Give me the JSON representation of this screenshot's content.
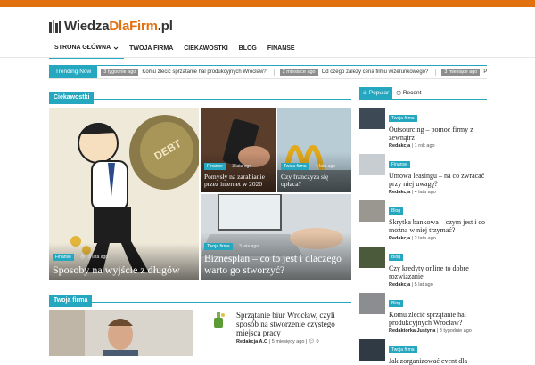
{
  "header": {
    "logo_prefix": "Wiedza",
    "logo_accent": "DlaFirm",
    "logo_suffix": ".pl",
    "accent_color": "#e1700e",
    "theme_color": "#25a7bf"
  },
  "nav": {
    "items": [
      {
        "label": "STRONA GŁÓWNA"
      },
      {
        "label": "TWOJA FIRMA"
      },
      {
        "label": "CIEKAWOSTKI"
      },
      {
        "label": "BLOG"
      },
      {
        "label": "FINANSE"
      }
    ]
  },
  "trending": {
    "label": "Trending Now",
    "items": [
      {
        "time": "3 tygodnie ago",
        "title": "Komu zlecić sprzątanie hal produkcyjnych Wrocław?"
      },
      {
        "time": "2 miesiące ago",
        "title": "Od czego zależy cena filmu wizerunkowego?"
      },
      {
        "time": "3 miesiące ago",
        "title": "P"
      }
    ]
  },
  "ciekawostki": {
    "heading": "Ciekawostki",
    "tiles": [
      {
        "category": "Finanse",
        "time": "3 lata ago",
        "title": "Sposoby na wyjście z długów"
      },
      {
        "category": "Finanse",
        "time": "3 lata ago",
        "title": "Pomysły na zarabianie przez internet w 2020"
      },
      {
        "category": "Twoja firma",
        "time": "4 lata ago",
        "title": "Czy franczyza się opłaca?"
      },
      {
        "category": "Twoja firma",
        "time": "3 lata ago",
        "title": "Biznesplan – co to jest i dlaczego warto go stworzyć?"
      }
    ]
  },
  "sidebar": {
    "tab_popular": "Popular",
    "tab_recent": "Recent",
    "items": [
      {
        "category": "Twoja firma",
        "title": "Outsourcing – pomoc firmy z zewnątrz",
        "author": "Redakcja",
        "time": "1 rok ago"
      },
      {
        "category": "Finanse",
        "title": "Umowa leasingu – na co zwracać przy niej uwagę?",
        "author": "Redakcja",
        "time": "4 lata ago"
      },
      {
        "category": "Blog",
        "title": "Skrytka bankowa – czym jest i co można w niej trzymać?",
        "author": "Redakcja",
        "time": "2 lata ago"
      },
      {
        "category": "Blog",
        "title": "Czy kredyty online to dobre rozwiązanie",
        "author": "Redakcja",
        "time": "5 lat ago"
      },
      {
        "category": "Blog",
        "title": "Komu zlecić sprzątanie hal produkcyjnych Wrocław?",
        "author": "Redaktorka Justyna",
        "time": "3 tygodnie ago"
      },
      {
        "category": "Twoja firma",
        "title": "Jak zorganizować event dla"
      }
    ]
  },
  "twoja_firma": {
    "heading": "Twoja firma",
    "article": {
      "title": "Sprzątanie biur Wrocław, czyli sposób na stworzenie czystego miejsca pracy",
      "author": "Redakcja A.O",
      "time": "5 miesięcy ago",
      "comments": "0"
    }
  }
}
